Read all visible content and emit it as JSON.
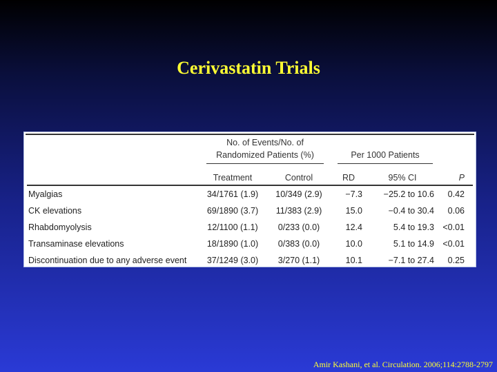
{
  "slide": {
    "title": "Cerivastatin Trials",
    "citation": "Amir Kashani, et al. Circulation. 2006;114:2788-2797"
  },
  "table": {
    "group_headers": {
      "events_line1": "No. of Events/No. of",
      "events_line2": "Randomized Patients (%)",
      "per1000": "Per 1000 Patients"
    },
    "columns": {
      "treatment": "Treatment",
      "control": "Control",
      "rd": "RD",
      "ci": "95% CI",
      "p": "P"
    },
    "rows": [
      {
        "label": "Myalgias",
        "treatment": "34/1761 (1.9)",
        "control": "10/349 (2.9)",
        "rd": "−7.3",
        "ci": "−25.2 to 10.6",
        "p": "0.42"
      },
      {
        "label": "CK elevations",
        "treatment": "69/1890 (3.7)",
        "control": "11/383 (2.9)",
        "rd": "15.0",
        "ci": "−0.4 to 30.4",
        "p": "0.06"
      },
      {
        "label": "Rhabdomyolysis",
        "treatment": "12/1100 (1.1)",
        "control": "0/233 (0.0)",
        "rd": "12.4",
        "ci": "5.4 to 19.3",
        "p": "<0.01"
      },
      {
        "label": "Transaminase elevations",
        "treatment": "18/1890 (1.0)",
        "control": "0/383 (0.0)",
        "rd": "10.0",
        "ci": "5.1 to 14.9",
        "p": "<0.01"
      },
      {
        "label": "Discontinuation due to any adverse event",
        "treatment": "37/1249 (3.0)",
        "control": "3/270 (1.1)",
        "rd": "10.1",
        "ci": "−7.1 to 27.4",
        "p": "0.25"
      }
    ]
  },
  "colors": {
    "title": "#ffff33",
    "citation": "#ffff33",
    "background_top": "#000000",
    "background_bottom": "#2a3ad6",
    "table_background": "#ffffff"
  }
}
